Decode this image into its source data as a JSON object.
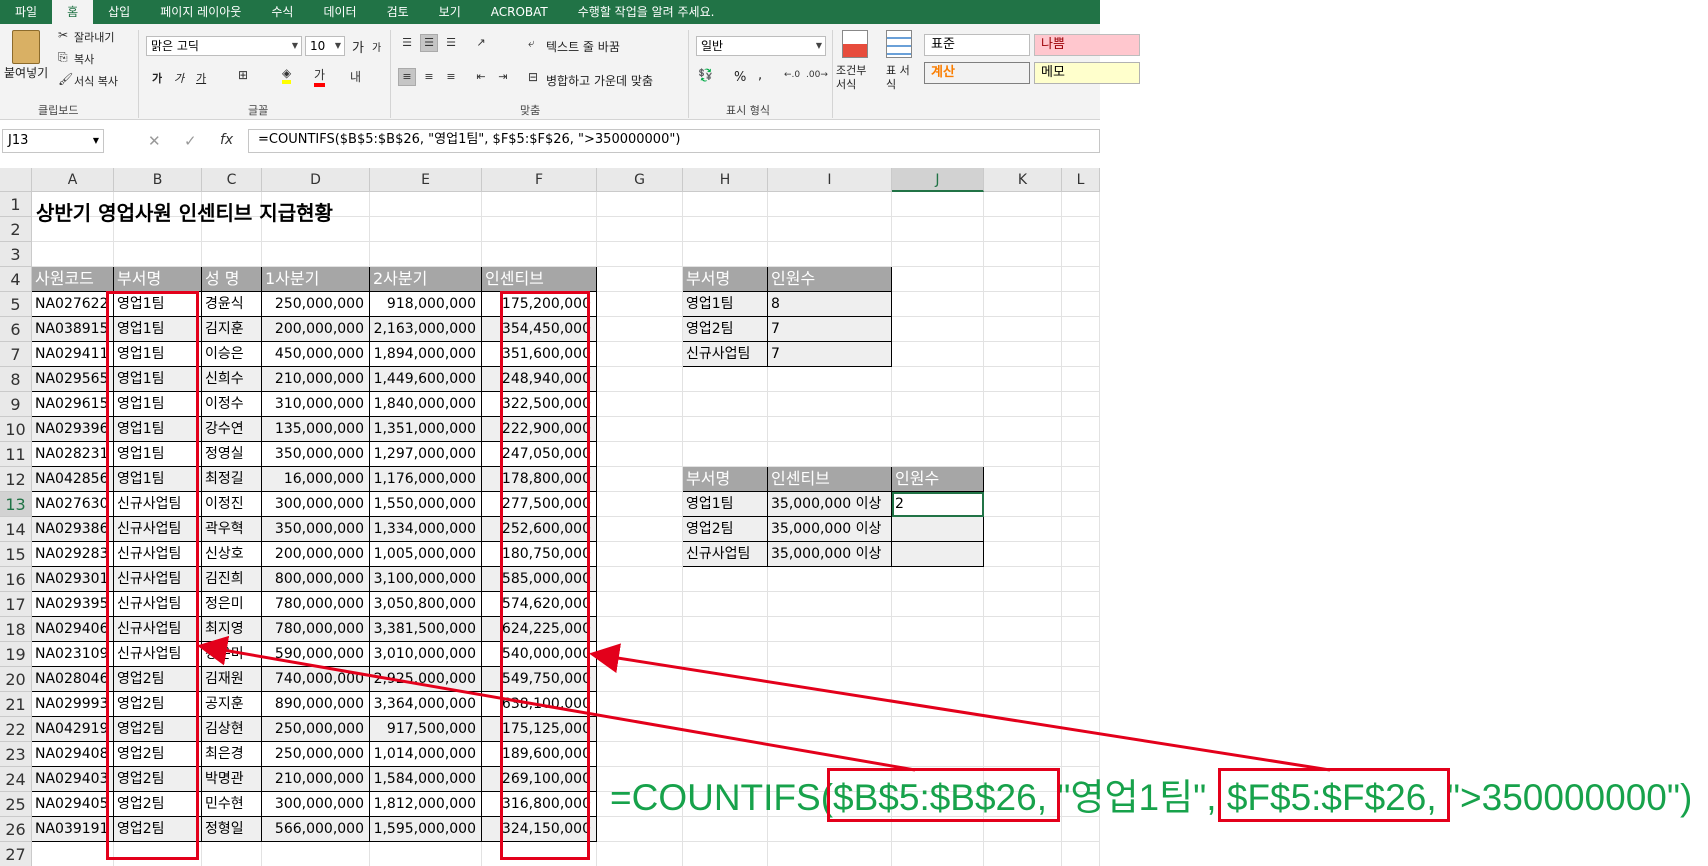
{
  "ribbon_tabs": [
    "파일",
    "홈",
    "삽입",
    "페이지 레이아웃",
    "수식",
    "데이터",
    "검토",
    "보기",
    "ACROBAT",
    "수행할 작업을 알려 주세요."
  ],
  "clipboard": {
    "paste": "붙여넣기",
    "cut": "잘라내기",
    "copy": "복사",
    "format_painter": "서식 복사",
    "group": "클립보드"
  },
  "font": {
    "name": "맑은 고딕",
    "size": "10",
    "group": "글꼴",
    "grow": "가",
    "shrink": "가",
    "bold": "가",
    "italic": "가",
    "underline": "가"
  },
  "alignment": {
    "wrap": "텍스트 줄 바꿈",
    "merge": "병합하고 가운데 맞춤",
    "group": "맞춤"
  },
  "number": {
    "format": "일반",
    "percent": "%",
    "comma": ",",
    "group": "표시 형식"
  },
  "styles": {
    "conditional": "조건부 서식",
    "table": "표 서식",
    "normal": "표준",
    "bad": "나쁨",
    "calc": "계산",
    "memo": "메모"
  },
  "colors": {
    "excel_green": "#217346",
    "header_gray": "#a6a6a6",
    "red": "#e3001b",
    "green_text": "#17a24b"
  },
  "namebox": "J13",
  "formula": "=COUNTIFS($B$5:$B$26, \"영업1팀\", $F$5:$F$26, \">350000000\")",
  "columns": [
    "A",
    "B",
    "C",
    "D",
    "E",
    "F",
    "G",
    "H",
    "I",
    "J",
    "K",
    "L"
  ],
  "rows": [
    "1",
    "2",
    "3",
    "4",
    "5",
    "6",
    "7",
    "8",
    "9",
    "10",
    "11",
    "12",
    "13",
    "14",
    "15",
    "16",
    "17",
    "18",
    "19",
    "20",
    "21",
    "22",
    "23",
    "24",
    "25",
    "26",
    "27"
  ],
  "sheet_title": "상반기 영업사원 인센티브 지급현황",
  "main_table": {
    "headers": [
      "사원코드",
      "부서명",
      "성  명",
      "1사분기",
      "2사분기",
      "인센티브"
    ],
    "rows": [
      [
        "NA027622",
        "영업1팀",
        "경윤식",
        "250,000,000",
        "918,000,000",
        "175,200,000"
      ],
      [
        "NA038915",
        "영업1팀",
        "김지훈",
        "200,000,000",
        "2,163,000,000",
        "354,450,000"
      ],
      [
        "NA029411",
        "영업1팀",
        "이승은",
        "450,000,000",
        "1,894,000,000",
        "351,600,000"
      ],
      [
        "NA029565",
        "영업1팀",
        "신희수",
        "210,000,000",
        "1,449,600,000",
        "248,940,000"
      ],
      [
        "NA029615",
        "영업1팀",
        "이정수",
        "310,000,000",
        "1,840,000,000",
        "322,500,000"
      ],
      [
        "NA029396",
        "영업1팀",
        "강수연",
        "135,000,000",
        "1,351,000,000",
        "222,900,000"
      ],
      [
        "NA028231",
        "영업1팀",
        "정영실",
        "350,000,000",
        "1,297,000,000",
        "247,050,000"
      ],
      [
        "NA042856",
        "영업1팀",
        "최정길",
        "16,000,000",
        "1,176,000,000",
        "178,800,000"
      ],
      [
        "NA027630",
        "신규사업팀",
        "이정진",
        "300,000,000",
        "1,550,000,000",
        "277,500,000"
      ],
      [
        "NA029386",
        "신규사업팀",
        "곽우혁",
        "350,000,000",
        "1,334,000,000",
        "252,600,000"
      ],
      [
        "NA029283",
        "신규사업팀",
        "신상호",
        "200,000,000",
        "1,005,000,000",
        "180,750,000"
      ],
      [
        "NA029301",
        "신규사업팀",
        "김진희",
        "800,000,000",
        "3,100,000,000",
        "585,000,000"
      ],
      [
        "NA029395",
        "신규사업팀",
        "정은미",
        "780,000,000",
        "3,050,800,000",
        "574,620,000"
      ],
      [
        "NA029406",
        "신규사업팀",
        "최지영",
        "780,000,000",
        "3,381,500,000",
        "624,225,000"
      ],
      [
        "NA023109",
        "신규사업팀",
        "강은미",
        "590,000,000",
        "3,010,000,000",
        "540,000,000"
      ],
      [
        "NA028046",
        "영업2팀",
        "김재원",
        "740,000,000",
        "2,925,000,000",
        "549,750,000"
      ],
      [
        "NA029993",
        "영업2팀",
        "공지훈",
        "890,000,000",
        "3,364,000,000",
        "638,100,000"
      ],
      [
        "NA042919",
        "영업2팀",
        "김상현",
        "250,000,000",
        "917,500,000",
        "175,125,000"
      ],
      [
        "NA029408",
        "영업2팀",
        "최은경",
        "250,000,000",
        "1,014,000,000",
        "189,600,000"
      ],
      [
        "NA029403",
        "영업2팀",
        "박명관",
        "210,000,000",
        "1,584,000,000",
        "269,100,000"
      ],
      [
        "NA029405",
        "영업2팀",
        "민수현",
        "300,000,000",
        "1,812,000,000",
        "316,800,000"
      ],
      [
        "NA039191",
        "영업2팀",
        "정형일",
        "566,000,000",
        "1,595,000,000",
        "324,150,000"
      ]
    ]
  },
  "summary1": {
    "headers": [
      "부서명",
      "인원수"
    ],
    "rows": [
      [
        "영업1팀",
        "8"
      ],
      [
        "영업2팀",
        "7"
      ],
      [
        "신규사업팀",
        "7"
      ]
    ]
  },
  "summary2": {
    "headers": [
      "부서명",
      "인센티브",
      "인원수"
    ],
    "rows": [
      [
        "영업1팀",
        "35,000,000 이상",
        "2"
      ],
      [
        "영업2팀",
        "35,000,000 이상",
        ""
      ],
      [
        "신규사업팀",
        "35,000,000 이상",
        ""
      ]
    ]
  },
  "annotation": {
    "prefix": "=COUNTIFS(",
    "range1": "$B$5:$B$26,",
    "middle": " \"영업1팀\", ",
    "range2": "$F$5:$F$26,",
    "suffix": " \">350000000\")"
  }
}
